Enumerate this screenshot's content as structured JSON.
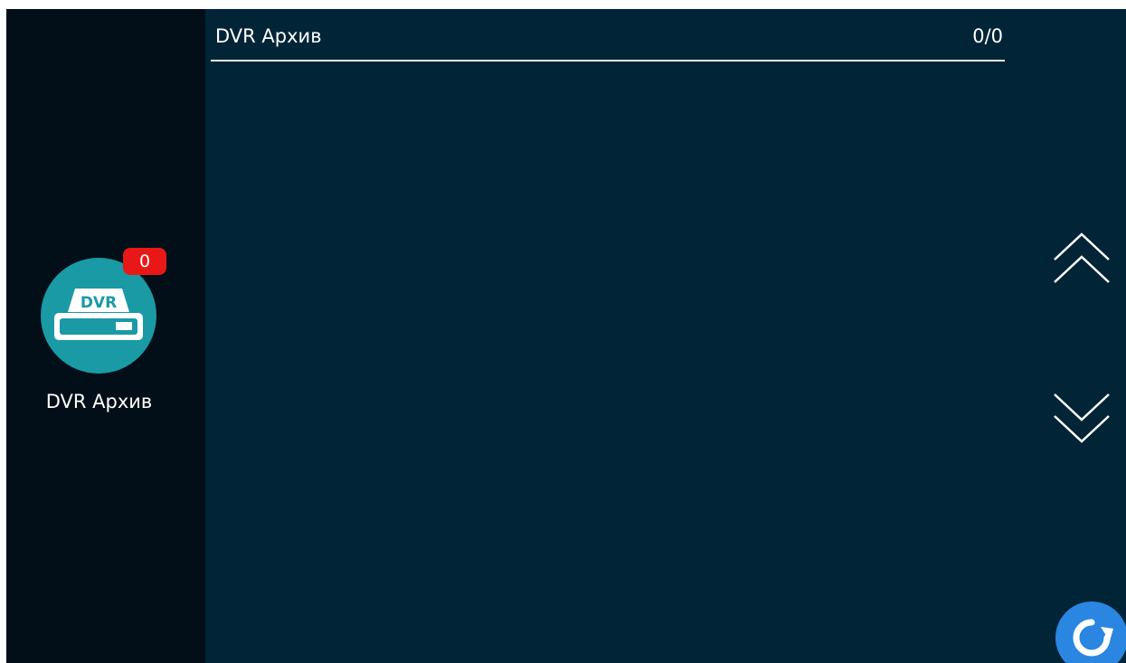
{
  "header": {
    "title": "DVR Архив",
    "count": "0/0"
  },
  "sidebar": {
    "item": {
      "label": "DVR Архив",
      "icon_text": "DVR",
      "badge": "0",
      "icon": "dvr-icon"
    }
  },
  "controls": {
    "scroll_up_icon": "chevron-up-double-icon",
    "scroll_down_icon": "chevron-down-double-icon",
    "refresh_icon": "refresh-icon"
  },
  "colors": {
    "background": "#022437",
    "sidebar": "#020f18",
    "accent_teal": "#1a9aa5",
    "badge_red": "#e81818",
    "refresh_blue": "#2a86e0"
  }
}
